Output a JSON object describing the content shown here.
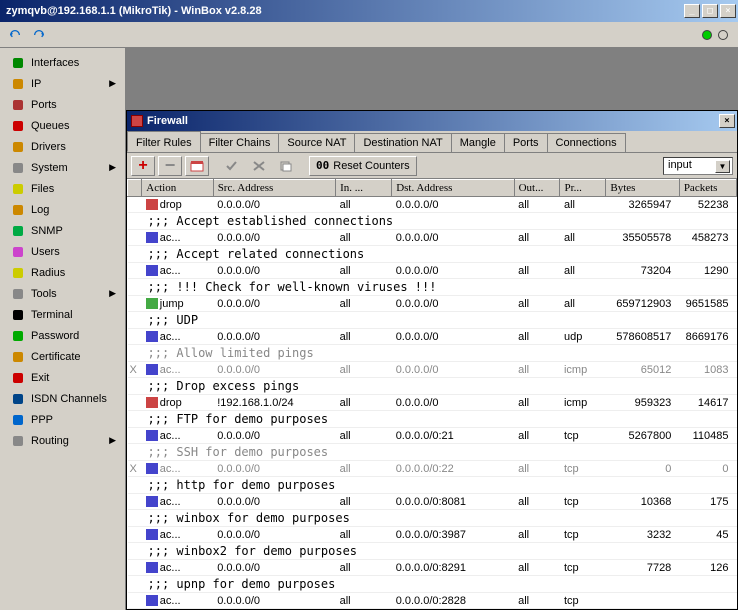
{
  "window": {
    "title": "zymqvb@192.168.1.1 (MikroTik) - WinBox v2.8.28"
  },
  "toolbar1": {
    "undo_title": "Undo",
    "redo_title": "Redo"
  },
  "sidebar": {
    "items": [
      {
        "label": "Interfaces",
        "arrow": false,
        "color": "#080"
      },
      {
        "label": "IP",
        "arrow": true,
        "color": "#c80"
      },
      {
        "label": "Ports",
        "arrow": false,
        "color": "#a33"
      },
      {
        "label": "Queues",
        "arrow": false,
        "color": "#c00"
      },
      {
        "label": "Drivers",
        "arrow": false,
        "color": "#c80"
      },
      {
        "label": "System",
        "arrow": true,
        "color": "#888"
      },
      {
        "label": "Files",
        "arrow": false,
        "color": "#cc0"
      },
      {
        "label": "Log",
        "arrow": false,
        "color": "#c80"
      },
      {
        "label": "SNMP",
        "arrow": false,
        "color": "#0a4"
      },
      {
        "label": "Users",
        "arrow": false,
        "color": "#c4c"
      },
      {
        "label": "Radius",
        "arrow": false,
        "color": "#cc0"
      },
      {
        "label": "Tools",
        "arrow": true,
        "color": "#888"
      },
      {
        "label": "Terminal",
        "arrow": false,
        "color": "#000"
      },
      {
        "label": "Password",
        "arrow": false,
        "color": "#0a0"
      },
      {
        "label": "Certificate",
        "arrow": false,
        "color": "#c80"
      },
      {
        "label": "Exit",
        "arrow": false,
        "color": "#c00"
      },
      {
        "label": "ISDN Channels",
        "arrow": false,
        "color": "#048"
      },
      {
        "label": "PPP",
        "arrow": false,
        "color": "#06c"
      },
      {
        "label": "Routing",
        "arrow": true,
        "color": "#888"
      }
    ]
  },
  "firewall": {
    "title": "Firewall",
    "tabs": [
      {
        "label": "Filter Rules",
        "active": true
      },
      {
        "label": "Filter Chains",
        "active": false
      },
      {
        "label": "Source NAT",
        "active": false
      },
      {
        "label": "Destination NAT",
        "active": false
      },
      {
        "label": "Mangle",
        "active": false
      },
      {
        "label": "Ports",
        "active": false
      },
      {
        "label": "Connections",
        "active": false
      }
    ],
    "reset_label": "Reset Counters",
    "chain": "input",
    "columns": [
      "",
      "Action",
      "Src. Address",
      "In. ...",
      "Dst. Address",
      "Out...",
      "Pr...",
      "Bytes",
      "Packets"
    ],
    "rows": [
      {
        "t": "r",
        "mark": "",
        "action": "drop",
        "ai": "drop",
        "src": "0.0.0.0/0",
        "in": "all",
        "dst": "0.0.0.0/0",
        "out": "all",
        "pr": "all",
        "bytes": "3265947",
        "pkts": "52238"
      },
      {
        "t": "c",
        "txt": ";;; Accept established connections"
      },
      {
        "t": "r",
        "mark": "",
        "action": "ac...",
        "ai": "acc",
        "src": "0.0.0.0/0",
        "in": "all",
        "dst": "0.0.0.0/0",
        "out": "all",
        "pr": "all",
        "bytes": "35505578",
        "pkts": "458273"
      },
      {
        "t": "c",
        "txt": ";;; Accept related connections"
      },
      {
        "t": "r",
        "mark": "",
        "action": "ac...",
        "ai": "acc",
        "src": "0.0.0.0/0",
        "in": "all",
        "dst": "0.0.0.0/0",
        "out": "all",
        "pr": "all",
        "bytes": "73204",
        "pkts": "1290"
      },
      {
        "t": "c",
        "txt": ";;; !!! Check for well-known viruses !!!"
      },
      {
        "t": "r",
        "mark": "",
        "action": "jump",
        "ai": "jump",
        "src": "0.0.0.0/0",
        "in": "all",
        "dst": "0.0.0.0/0",
        "out": "all",
        "pr": "all",
        "bytes": "659712903",
        "pkts": "9651585"
      },
      {
        "t": "c",
        "txt": ";;; UDP"
      },
      {
        "t": "r",
        "mark": "",
        "action": "ac...",
        "ai": "acc",
        "src": "0.0.0.0/0",
        "in": "all",
        "dst": "0.0.0.0/0",
        "out": "all",
        "pr": "udp",
        "bytes": "578608517",
        "pkts": "8669176"
      },
      {
        "t": "c",
        "dis": true,
        "txt": ";;; Allow limited pings"
      },
      {
        "t": "r",
        "dis": true,
        "mark": "X",
        "action": "ac...",
        "ai": "acc",
        "src": "0.0.0.0/0",
        "in": "all",
        "dst": "0.0.0.0/0",
        "out": "all",
        "pr": "icmp",
        "bytes": "65012",
        "pkts": "1083"
      },
      {
        "t": "c",
        "txt": ";;; Drop excess pings"
      },
      {
        "t": "r",
        "mark": "",
        "action": "drop",
        "ai": "drop",
        "src": "!192.168.1.0/24",
        "in": "all",
        "dst": "0.0.0.0/0",
        "out": "all",
        "pr": "icmp",
        "bytes": "959323",
        "pkts": "14617"
      },
      {
        "t": "c",
        "txt": ";;; FTP for demo purposes"
      },
      {
        "t": "r",
        "mark": "",
        "action": "ac...",
        "ai": "acc",
        "src": "0.0.0.0/0",
        "in": "all",
        "dst": "0.0.0.0/0:21",
        "out": "all",
        "pr": "tcp",
        "bytes": "5267800",
        "pkts": "110485"
      },
      {
        "t": "c",
        "dis": true,
        "txt": ";;; SSH for demo purposes"
      },
      {
        "t": "r",
        "dis": true,
        "mark": "X",
        "action": "ac...",
        "ai": "acc",
        "src": "0.0.0.0/0",
        "in": "all",
        "dst": "0.0.0.0/0:22",
        "out": "all",
        "pr": "tcp",
        "bytes": "0",
        "pkts": "0"
      },
      {
        "t": "c",
        "txt": ";;; http for demo purposes"
      },
      {
        "t": "r",
        "mark": "",
        "action": "ac...",
        "ai": "acc",
        "src": "0.0.0.0/0",
        "in": "all",
        "dst": "0.0.0.0/0:8081",
        "out": "all",
        "pr": "tcp",
        "bytes": "10368",
        "pkts": "175"
      },
      {
        "t": "c",
        "txt": ";;; winbox for demo purposes"
      },
      {
        "t": "r",
        "mark": "",
        "action": "ac...",
        "ai": "acc",
        "src": "0.0.0.0/0",
        "in": "all",
        "dst": "0.0.0.0/0:3987",
        "out": "all",
        "pr": "tcp",
        "bytes": "3232",
        "pkts": "45"
      },
      {
        "t": "c",
        "txt": ";;; winbox2 for demo purposes"
      },
      {
        "t": "r",
        "mark": "",
        "action": "ac...",
        "ai": "acc",
        "src": "0.0.0.0/0",
        "in": "all",
        "dst": "0.0.0.0/0:8291",
        "out": "all",
        "pr": "tcp",
        "bytes": "7728",
        "pkts": "126"
      },
      {
        "t": "c",
        "txt": ";;; upnp for demo purposes"
      },
      {
        "t": "r",
        "mark": "",
        "action": "ac...",
        "ai": "acc",
        "src": "0.0.0.0/0",
        "in": "all",
        "dst": "0.0.0.0/0:2828",
        "out": "all",
        "pr": "tcp",
        "bytes": "",
        "pkts": ""
      }
    ]
  }
}
